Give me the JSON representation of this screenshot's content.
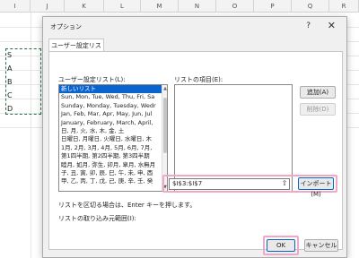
{
  "sheet": {
    "columns": [
      "I",
      "J",
      "K",
      "L",
      "M",
      "N",
      "O",
      "P",
      "Q",
      "R"
    ],
    "cells": [
      "S",
      "A",
      "B",
      "C",
      "D"
    ]
  },
  "dialog": {
    "title": "オプション",
    "help": "?",
    "close": "✕",
    "tab": "ユーザー設定リスト",
    "custom_lists_label": "ユーザー設定リスト(L):",
    "entries_label": "リストの項目(E):",
    "lists": [
      "新しいリスト",
      "Sun, Mon, Tue, Wed, Thu, Fri, Sa",
      "Sunday, Monday, Tuesday, Wedr",
      "Jan, Feb, Mar, Apr, May, Jun, Jul",
      "January, February, March, April,",
      "日, 月, 火, 水, 木, 金, 土",
      "日曜日, 月曜日, 火曜日, 水曜日, 木",
      "1月, 2月, 3月, 4月, 5月, 6月, 7月,",
      "第1四半期, 第2四半期, 第3四半期",
      "睦月, 如月, 弥生, 卯月, 皐月, 水無月",
      "子, 丑, 寅, 卯, 辰, 巳, 午, 未, 申, 酉",
      "甲, 乙, 丙, 丁, 戊, 己, 庚, 辛, 壬, 癸"
    ],
    "add_button": "追加(A)",
    "delete_button": "削除(D)",
    "separator_hint": "リストを区切る場合は、Enter キーを押します。",
    "import_label": "リストの取り込み元範囲(I):",
    "import_range": "$I$3:$I$7",
    "collapse_icon": "⇧",
    "import_button": "インポート(M)",
    "ok_button": "OK",
    "cancel_button": "キャンセル"
  },
  "colors": {
    "selection": "#0a64d0",
    "highlight": "#f3a7c7",
    "accent": "#0067c0"
  }
}
